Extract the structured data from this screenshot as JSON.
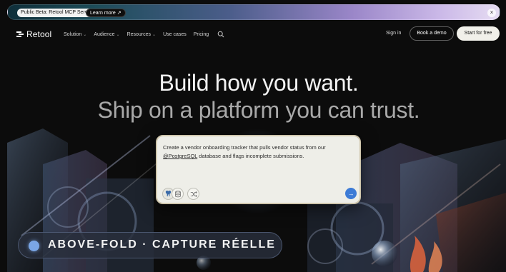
{
  "banner": {
    "badge": "Public Beta: Retool MCP Server",
    "learn_more": "Learn more ↗",
    "close_icon": "×"
  },
  "nav": {
    "brand": "Retool",
    "links": [
      {
        "label": "Solution",
        "dropdown": true
      },
      {
        "label": "Audience",
        "dropdown": true
      },
      {
        "label": "Resources",
        "dropdown": true
      },
      {
        "label": "Use cases",
        "dropdown": false
      },
      {
        "label": "Pricing",
        "dropdown": false
      }
    ],
    "search_icon": "search-icon",
    "sign_in": "Sign in",
    "book_demo": "Book a demo",
    "start_free": "Start for free"
  },
  "hero": {
    "title": "Build how you want.",
    "subtitle": "Ship on a platform you can trust."
  },
  "prompt": {
    "text_before": "Create a vendor onboarding tracker that pulls vendor status from our ",
    "mention": "@PostgreSQL",
    "text_after": " database and flags incomplete submissions.",
    "tools": [
      "postgresql-icon",
      "database-icon",
      "shuffle-icon"
    ],
    "send_icon": "→"
  },
  "caption": {
    "text": "ABOVE-FOLD · CAPTURE RÉELLE"
  },
  "colors": {
    "accent": "#3d7bd6",
    "card_border": "#cfc6ad",
    "cta_bg": "#f1f0ea"
  }
}
